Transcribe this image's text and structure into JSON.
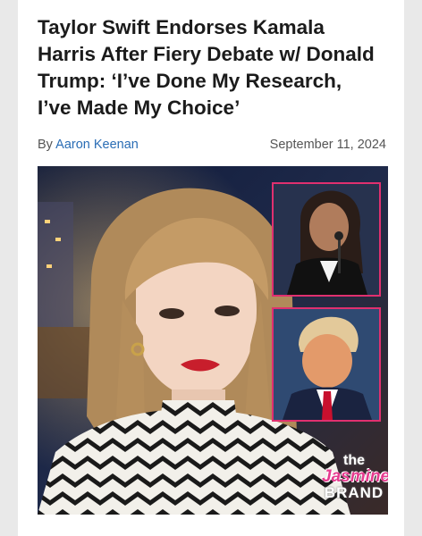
{
  "article": {
    "headline": "Taylor Swift Endorses Kamala Harris After Fiery Debate w/ Donald Trump: ‘I’ve Done My Research, I’ve Made My Choice’",
    "byline_prefix": "By",
    "author": "Aaron Keenan",
    "date": "September 11, 2024"
  },
  "image": {
    "main_subject": "taylor-swift-photo",
    "insets": [
      "kamala-harris-photo",
      "donald-trump-photo"
    ],
    "watermark": {
      "the": "the",
      "jasmine": "Jasmine",
      "brand": "BRAND"
    }
  },
  "colors": {
    "author_link": "#2a6db5",
    "inset_border": "#e0306f",
    "watermark_pink": "#e63b8f"
  }
}
